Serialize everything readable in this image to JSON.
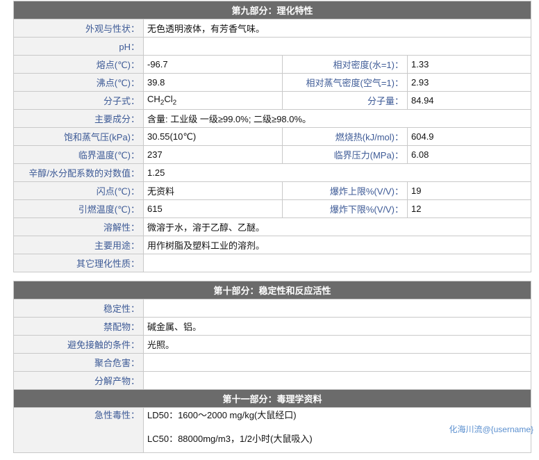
{
  "section9": {
    "title": "第九部分：理化特性",
    "appearance": {
      "label": "外观与性状：",
      "value": "无色透明液体，有芳香气味。"
    },
    "ph": {
      "label": "pH：",
      "value": ""
    },
    "melting": {
      "label": "熔点(℃)：",
      "value": "-96.7"
    },
    "density_water": {
      "label": "相对密度(水=1)：",
      "value": "1.33"
    },
    "boiling": {
      "label": "沸点(℃)：",
      "value": "39.8"
    },
    "vapor_density": {
      "label": "相对蒸气密度(空气=1)：",
      "value": "2.93"
    },
    "formula": {
      "label": "分子式：",
      "prefix": "CH",
      "sub1": "2",
      "mid": "Cl",
      "sub2": "2"
    },
    "mol_weight": {
      "label": "分子量：",
      "value": "84.94"
    },
    "composition": {
      "label": "主要成分：",
      "value": "含量: 工业级 一级≥99.0%; 二级≥98.0%。"
    },
    "vapor_pressure": {
      "label": "饱和蒸气压(kPa)：",
      "value": "30.55(10℃)"
    },
    "combustion_heat": {
      "label": "燃烧热(kJ/mol)：",
      "value": "604.9"
    },
    "critical_temp": {
      "label": "临界温度(℃)：",
      "value": "237"
    },
    "critical_pressure": {
      "label": "临界压力(MPa)：",
      "value": "6.08"
    },
    "partition": {
      "label": "辛醇/水分配系数的对数值：",
      "value": "1.25"
    },
    "flash_point": {
      "label": "闪点(℃)：",
      "value": "无资料"
    },
    "upper_limit": {
      "label": "爆炸上限%(V/V)：",
      "value": "19"
    },
    "ignition_temp": {
      "label": "引燃温度(℃)：",
      "value": "615"
    },
    "lower_limit": {
      "label": "爆炸下限%(V/V)：",
      "value": "12"
    },
    "solubility": {
      "label": "溶解性：",
      "value": "微溶于水，溶于乙醇、乙醚。"
    },
    "uses": {
      "label": "主要用途：",
      "value": "用作树脂及塑料工业的溶剂。"
    },
    "other": {
      "label": "其它理化性质：",
      "value": ""
    }
  },
  "section10": {
    "title": "第十部分：稳定性和反应活性",
    "stability": {
      "label": "稳定性：",
      "value": ""
    },
    "incompatible": {
      "label": "禁配物：",
      "value": "碱金属、铝。"
    },
    "avoid": {
      "label": "避免接触的条件：",
      "value": "光照。"
    },
    "polymerization": {
      "label": "聚合危害：",
      "value": ""
    },
    "decomposition": {
      "label": "分解产物：",
      "value": ""
    }
  },
  "section11": {
    "title": "第十一部分：毒理学资料",
    "acute": {
      "label": "急性毒性：",
      "ld50": "LD50：1600～2000 mg/kg(大鼠经口)",
      "lc50": "LC50：88000mg/m3，1/2小时(大鼠吸入)"
    }
  },
  "watermark": "化海川流@{username}"
}
